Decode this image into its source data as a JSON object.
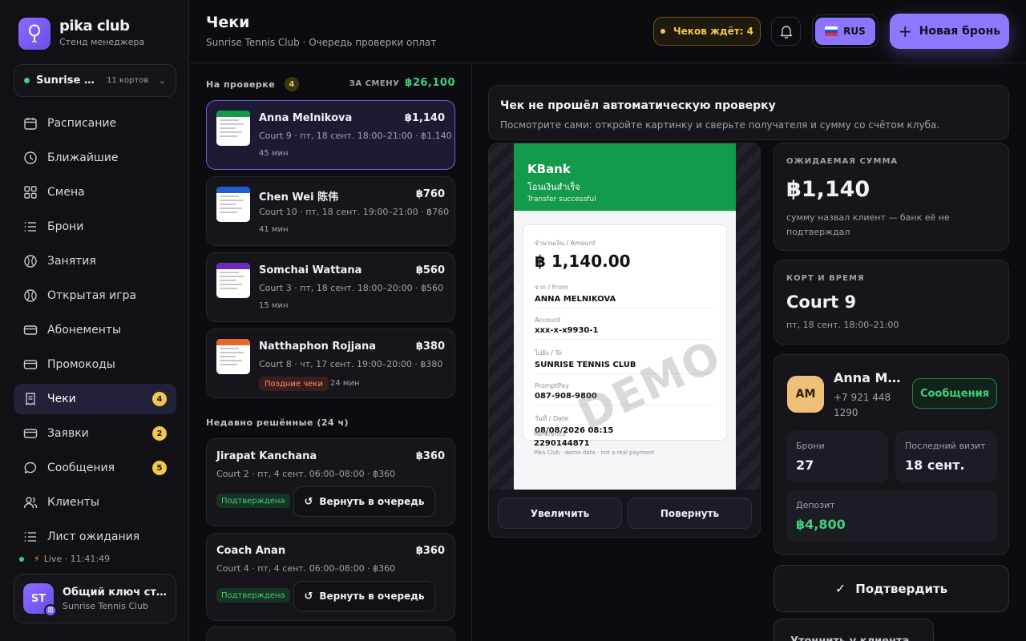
{
  "brand": {
    "name": "pika club",
    "subtitle": "Стенд менеджера"
  },
  "club": {
    "name": "Sunrise Tennis Club",
    "courts": "11 кортов"
  },
  "nav": [
    {
      "label": "Расписание",
      "icon": "calendar-icon"
    },
    {
      "label": "Ближайшие",
      "icon": "clock-icon"
    },
    {
      "label": "Смена",
      "icon": "grid-icon"
    },
    {
      "label": "Брони",
      "icon": "list-icon"
    },
    {
      "label": "Занятия",
      "icon": "ball-icon"
    },
    {
      "label": "Открытая игра",
      "icon": "ball-icon"
    },
    {
      "label": "Абонементы",
      "icon": "card-icon"
    },
    {
      "label": "Промокоды",
      "icon": "card-icon"
    },
    {
      "label": "Чеки",
      "icon": "receipt-icon",
      "badge": "4",
      "active": true
    },
    {
      "label": "Заявки",
      "icon": "card-icon",
      "badge": "2"
    },
    {
      "label": "Сообщения",
      "icon": "chat-icon",
      "badge": "5"
    },
    {
      "label": "Клиенты",
      "icon": "users-icon"
    },
    {
      "label": "Лист ожидания",
      "icon": "list-icon"
    }
  ],
  "live": "Live · 11:41:49",
  "account": {
    "initials": "ST",
    "title": "Общий ключ стойки",
    "club": "Sunrise Tennis Club"
  },
  "header": {
    "title": "Чеки",
    "subtitle": "Sunrise Tennis Club · Очередь проверки оплат",
    "waiting": "Чеков ждёт: 4",
    "lang": "RUS",
    "new_booking": "Новая бронь"
  },
  "queue": {
    "heading": "На проверке",
    "count": "4",
    "shift_label": "ЗА СМЕНУ",
    "shift_total": "฿26,100",
    "items": [
      {
        "name": "Anna Melnikova",
        "amount": "฿1,140",
        "meta": "Court 9 · пт, 18 сент. 18:00–21:00 · ฿1,140",
        "time": "45 мин",
        "color": "#149a4b"
      },
      {
        "name": "Chen Wei 陈伟",
        "amount": "฿760",
        "meta": "Court 10 · пт, 18 сент. 19:00–21:00 · ฿760",
        "time": "41 мин",
        "color": "#1d5fd1"
      },
      {
        "name": "Somchai Wattana",
        "amount": "฿560",
        "meta": "Court 3 · пт, 18 сент. 18:00–20:00 · ฿560",
        "time": "15 мин",
        "color": "#6a2bb8"
      },
      {
        "name": "Natthaphon Rojjana",
        "amount": "฿380",
        "meta": "Court 8 · чт, 17 сент. 19:00–20:00 · ฿380",
        "late": "Поздние чеки",
        "time": "24 мин",
        "color": "#e5692b"
      }
    ]
  },
  "recent": {
    "heading": "Недавно решённые (24 ч)",
    "items": [
      {
        "name": "Jirapat Kanchana",
        "amount": "฿360",
        "meta": "Court 2 · пт, 4 сент. 06:00–08:00 · ฿360",
        "status": "Подтверждена",
        "action": "Вернуть в очередь"
      },
      {
        "name": "Coach Anan",
        "amount": "฿360",
        "meta": "Court 4 · пт, 4 сент. 06:00–08:00 · ฿360",
        "status": "Подтверждена",
        "action": "Вернуть в очередь"
      }
    ]
  },
  "notice": {
    "title": "Чек не прошёл автоматическую проверку",
    "text": "Посмотрите сами: откройте картинку и сверьте получателя и сумму со счётом клуба."
  },
  "slip": {
    "bank": "KBank",
    "thai": "โอนเงินสำเร็จ",
    "status": "Transfer successful",
    "amount_label": "จำนวนเงิน / Amount",
    "amount": "฿ 1,140.00",
    "from_label": "จาก / From",
    "from": "ANNA MELNIKOVA",
    "account_label": "Account",
    "account": "xxx-x-x9930-1",
    "to_label": "ไปยัง / To",
    "to": "SUNRISE TENNIS CLUB",
    "promptpay_label": "PromptPay",
    "promptpay": "087-908-9800",
    "date_label": "วันที่ / Date",
    "date": "08/08/2026  08:15",
    "ref_label": "Reference",
    "ref": "2290144871",
    "footer": "Pika Club · demo data · not a real payment",
    "watermark": "DEMO"
  },
  "viewer": {
    "zoom": "Увеличить",
    "rotate": "Повернуть"
  },
  "expected": {
    "label": "ОЖИДАЕМАЯ СУММА",
    "amount": "฿1,140",
    "note": "сумму назвал клиент — банк её не подтверждал"
  },
  "court": {
    "label": "КОРТ И ВРЕМЯ",
    "name": "Court 9",
    "time": "пт, 18 сент. 18:00–21:00"
  },
  "client": {
    "initials": "AM",
    "name": "Anna Melnikova",
    "phone": "+7 921 448 1290",
    "messages": "Сообщения",
    "bookings_label": "Брони",
    "bookings": "27",
    "last_visit_label": "Последний визит",
    "last_visit": "18 сент.",
    "deposit_label": "Депозит",
    "deposit": "฿4,800"
  },
  "actions": {
    "confirm": "Подтвердить",
    "clarify": "Уточнить у клиента"
  }
}
